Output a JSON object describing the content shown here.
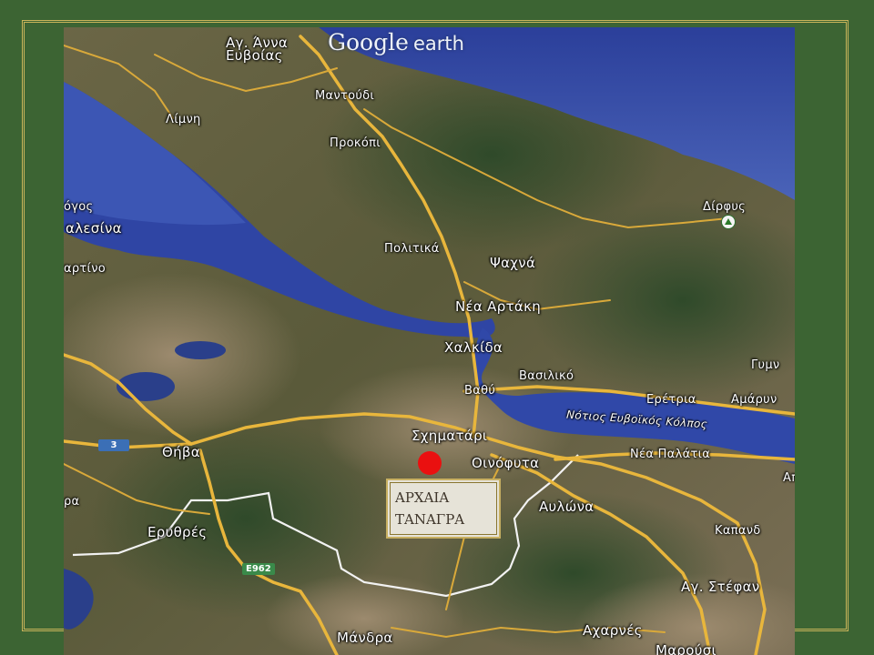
{
  "map": {
    "branding": {
      "google": "Google",
      "earth": "earth"
    },
    "places": {
      "ag_anna": "Αγ. Άννα",
      "evvoias": "Ευβοίας",
      "limni": "Λίμνη",
      "mantoudi": "Μαντούδι",
      "prokopi": "Προκόπι",
      "ogos": "όγος",
      "alesina": "αλεσίνα",
      "artino": "αρτίνο",
      "dirfys": "Δίρφυς",
      "politika": "Πολιτικά",
      "psachna": "Ψαχνά",
      "nea_artaki": "Νέα Αρτάκη",
      "chalkida": "Χαλκίδα",
      "vasiliko": "Βασιλικό",
      "gymn": "Γυμν",
      "vathy": "Βαθύ",
      "eretria": "Ερέτρια",
      "amarynthos": "Αμάρυν",
      "gulf": "Νότιος Ευβοϊκός Κόλπος",
      "schimatari": "Σχηματάρι",
      "thiva": "Θήβα",
      "oinofyta": "Οινόφυτα",
      "nea_palatia": "Νέα Παλάτια",
      "ap": "Απ",
      "pa": "ρα",
      "avlona": "Αυλώνα",
      "erythres": "Ερυθρές",
      "kapandriti": "Καπανδ",
      "ag_stefanos": "Αγ. Στέφαν",
      "mandra": "Μάνδρα",
      "acharnes": "Αχαρνές",
      "marousi": "Μαρούσι"
    },
    "road_badges": {
      "national_3": "3",
      "e962": "E962"
    },
    "site": {
      "line1": "ΑΡΧΑΙΑ",
      "line2": "ΤΑΝΑΓΡΑ",
      "marker_color": "#ea1010"
    },
    "colors": {
      "background": "#3c6433",
      "frame": "#c9b45a",
      "water": "#3a4fa8",
      "roads": "#e8b63c"
    }
  }
}
